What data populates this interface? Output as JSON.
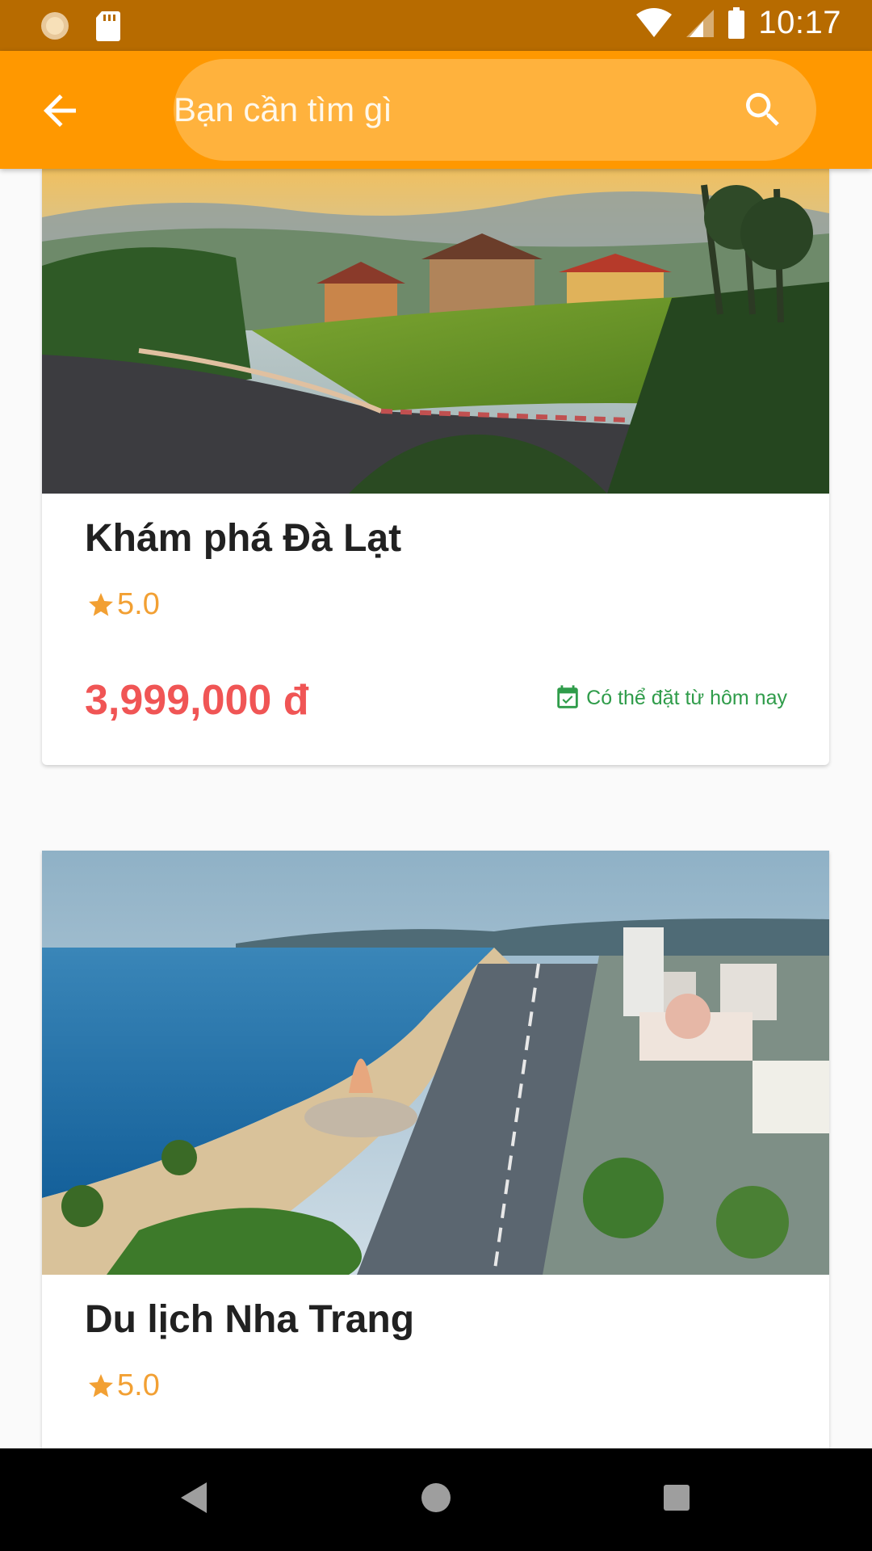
{
  "status_bar": {
    "time": "10:17",
    "left_icons": [
      "sun-settings-icon",
      "sd-card-icon"
    ],
    "right_icons": [
      "wifi-icon",
      "cell-signal-icon",
      "battery-icon"
    ]
  },
  "app_bar": {
    "back_icon": "arrow-back-icon",
    "search_placeholder": "Bạn cần tìm gì",
    "search_icon": "search-icon",
    "accent_color": "#ff9800"
  },
  "tours": [
    {
      "title": "Khám phá Đà Lạt",
      "rating": "5.0",
      "price": "3,999,000 đ",
      "availability": "Có thể đặt từ hôm nay"
    },
    {
      "title": "Du lịch Nha Trang",
      "rating": "5.0"
    }
  ],
  "colors": {
    "price": "#f05555",
    "rating": "#f2a033",
    "availability": "#2f9c4a"
  },
  "nav_bar": {
    "icons": [
      "nav-back-icon",
      "nav-home-icon",
      "nav-recents-icon"
    ]
  }
}
